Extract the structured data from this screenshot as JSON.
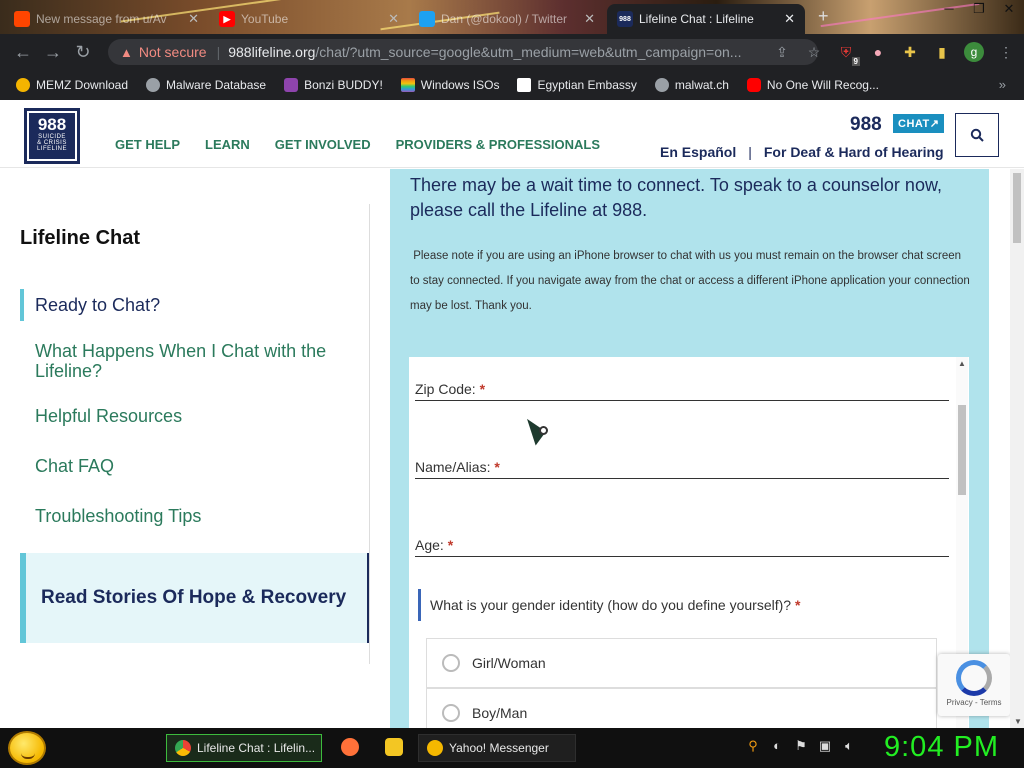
{
  "browser": {
    "tabs": [
      {
        "title": "New message from u/Av",
        "icon": "reddit-icon",
        "active": false
      },
      {
        "title": "YouTube",
        "icon": "youtube-icon",
        "active": false
      },
      {
        "title": "Dan (@dokool) / Twitter",
        "icon": "twitter-icon",
        "active": false
      },
      {
        "title": "Lifeline Chat : Lifeline",
        "icon": "988-icon",
        "active": true
      }
    ],
    "url_host": "988lifeline.org",
    "url_rest": "/chat/?utm_source=google&utm_medium=web&utm_campaign=on...",
    "security_label": "Not secure",
    "extension_badge": "9",
    "profile_initial": "g",
    "bookmarks": [
      {
        "label": "MEMZ Download",
        "color": "#f4b400"
      },
      {
        "label": "Malware Database",
        "color": "#9aa0a6"
      },
      {
        "label": "Bonzi BUDDY!",
        "color": "#8e44ad"
      },
      {
        "label": "Windows ISOs",
        "color": "#e74c3c"
      },
      {
        "label": "Egyptian Embassy",
        "color": "#ffffff"
      },
      {
        "label": "malwat.ch",
        "color": "#9aa0a6"
      },
      {
        "label": "No One Will Recog...",
        "color": "#ff0000"
      }
    ],
    "bookmarks_more": "»"
  },
  "site": {
    "logo_number": "988",
    "logo_lines": [
      "SUICIDE",
      "& CRISIS",
      "LIFELINE"
    ],
    "nav": [
      "GET HELP",
      "LEARN",
      "GET INVOLVED",
      "PROVIDERS & PROFESSIONALS"
    ],
    "brand_number": "988",
    "chat_badge": "CHAT↗",
    "lang_spanish": "En Español",
    "lang_divider": "|",
    "lang_deaf": "For Deaf & Hard of Hearing"
  },
  "sidebar": {
    "title": "Lifeline Chat",
    "items": [
      {
        "label": "Ready to Chat?",
        "active": true
      },
      {
        "label": "What Happens When I Chat with the Lifeline?",
        "active": false
      },
      {
        "label": "Helpful Resources",
        "active": false
      },
      {
        "label": "Chat FAQ",
        "active": false
      },
      {
        "label": "Troubleshooting Tips",
        "active": false
      }
    ],
    "stories": "Read Stories Of Hope & Recovery"
  },
  "main": {
    "wait_text": "There may be a wait time to connect. To speak to a counselor now, please call the Lifeline at 988.",
    "iphone_note": "󠀠 Please note if you are using an iPhone browser to chat with us you must remain on the browser chat screen to stay connected. If you navigate away from the chat or access a different iPhone application your connection may be lost. Thank you.",
    "form": {
      "zip_label": "Zip Code:",
      "name_label": "Name/Alias:",
      "age_label": "Age:",
      "required_mark": "*",
      "gender_question": "What is your gender identity (how do you define yourself)?",
      "gender_options": [
        "Girl/Woman",
        "Boy/Man"
      ]
    },
    "recaptcha_text": "Privacy - Terms"
  },
  "taskbar": {
    "tasks": [
      {
        "label": "Lifeline Chat : Lifelin...",
        "active": true
      },
      {
        "label": "Yahoo! Messenger",
        "active": false
      }
    ],
    "clock": "9:04 PM"
  }
}
